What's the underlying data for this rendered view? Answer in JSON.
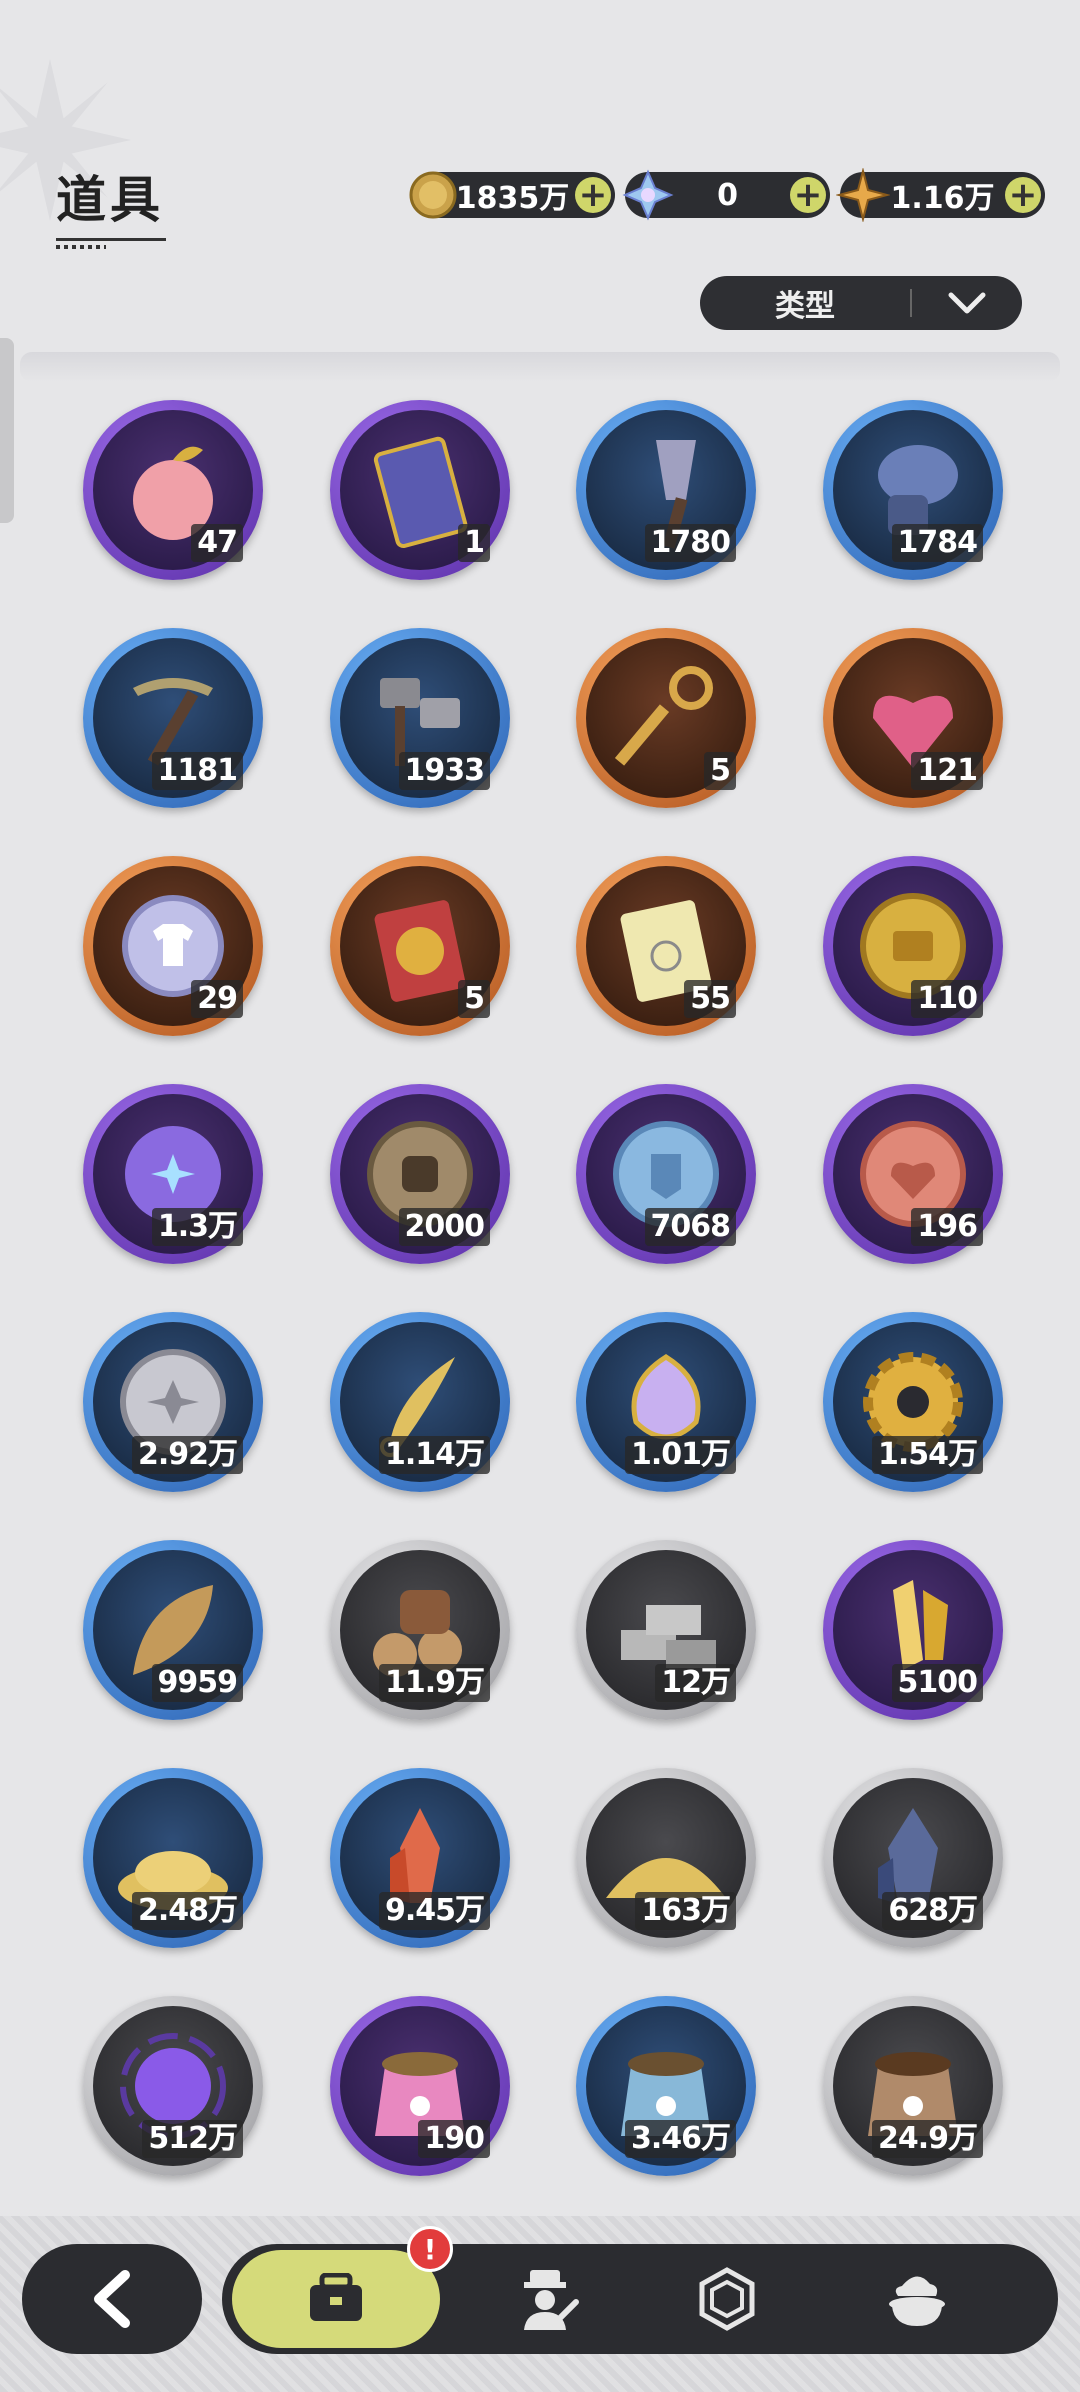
{
  "header": {
    "title": "道具"
  },
  "currencies": [
    {
      "name": "gold-coin",
      "value": "1835万"
    },
    {
      "name": "crystal",
      "value": "0"
    },
    {
      "name": "star-gem",
      "value": "1.16万"
    }
  ],
  "filter": {
    "label": "类型"
  },
  "items": [
    {
      "icon": "apple",
      "count": "47",
      "rarity": "purple"
    },
    {
      "icon": "card",
      "count": "1",
      "rarity": "purple"
    },
    {
      "icon": "shovel",
      "count": "1780",
      "rarity": "blue"
    },
    {
      "icon": "gauntlet",
      "count": "1784",
      "rarity": "blue"
    },
    {
      "icon": "pickaxe",
      "count": "1181",
      "rarity": "blue"
    },
    {
      "icon": "hammers",
      "count": "1933",
      "rarity": "blue"
    },
    {
      "icon": "golden-key",
      "count": "5",
      "rarity": "orange"
    },
    {
      "icon": "pink-heart-gem",
      "count": "121",
      "rarity": "orange"
    },
    {
      "icon": "shirt-coin",
      "count": "29",
      "rarity": "orange"
    },
    {
      "icon": "wheel-ticket",
      "count": "5",
      "rarity": "orange"
    },
    {
      "icon": "rainbow-ticket",
      "count": "55",
      "rarity": "orange"
    },
    {
      "icon": "gold-suitcase-coin",
      "count": "110",
      "rarity": "purple"
    },
    {
      "icon": "star-moon-coin",
      "count": "1.3万",
      "rarity": "purple"
    },
    {
      "icon": "fist-coin",
      "count": "2000",
      "rarity": "purple"
    },
    {
      "icon": "blue-emblem-coin",
      "count": "7068",
      "rarity": "purple"
    },
    {
      "icon": "heart-coin",
      "count": "196",
      "rarity": "purple"
    },
    {
      "icon": "silver-coin",
      "count": "2.92万",
      "rarity": "blue"
    },
    {
      "icon": "golden-blade",
      "count": "1.14万",
      "rarity": "blue"
    },
    {
      "icon": "scale-amulet",
      "count": "1.01万",
      "rarity": "blue"
    },
    {
      "icon": "gear",
      "count": "1.54万",
      "rarity": "blue"
    },
    {
      "icon": "leaf",
      "count": "9959",
      "rarity": "blue"
    },
    {
      "icon": "logs",
      "count": "11.9万",
      "rarity": "gray"
    },
    {
      "icon": "stone-bricks",
      "count": "12万",
      "rarity": "gray"
    },
    {
      "icon": "gold-crystal",
      "count": "5100",
      "rarity": "purple"
    },
    {
      "icon": "gold-sand",
      "count": "2.48万",
      "rarity": "blue"
    },
    {
      "icon": "red-crystal",
      "count": "9.45万",
      "rarity": "blue"
    },
    {
      "icon": "sand-pile",
      "count": "163万",
      "rarity": "gray"
    },
    {
      "icon": "dark-crystal",
      "count": "628万",
      "rarity": "gray"
    },
    {
      "icon": "purple-orb",
      "count": "512万",
      "rarity": "gray"
    },
    {
      "icon": "pink-paw-bag",
      "count": "190",
      "rarity": "purple"
    },
    {
      "icon": "blue-paw-bag",
      "count": "3.46万",
      "rarity": "blue"
    },
    {
      "icon": "brown-paw-bag",
      "count": "24.9万",
      "rarity": "gray"
    }
  ],
  "nav": {
    "tabs": [
      "bag-icon",
      "character-icon",
      "hexagon-icon",
      "food-icon"
    ],
    "badge": "!"
  },
  "colors": {
    "purple": "#7a4fc9",
    "blue": "#4a8fe0",
    "orange": "#e0813f",
    "gray": "#b8b8bc",
    "accent": "#d5da7a"
  }
}
